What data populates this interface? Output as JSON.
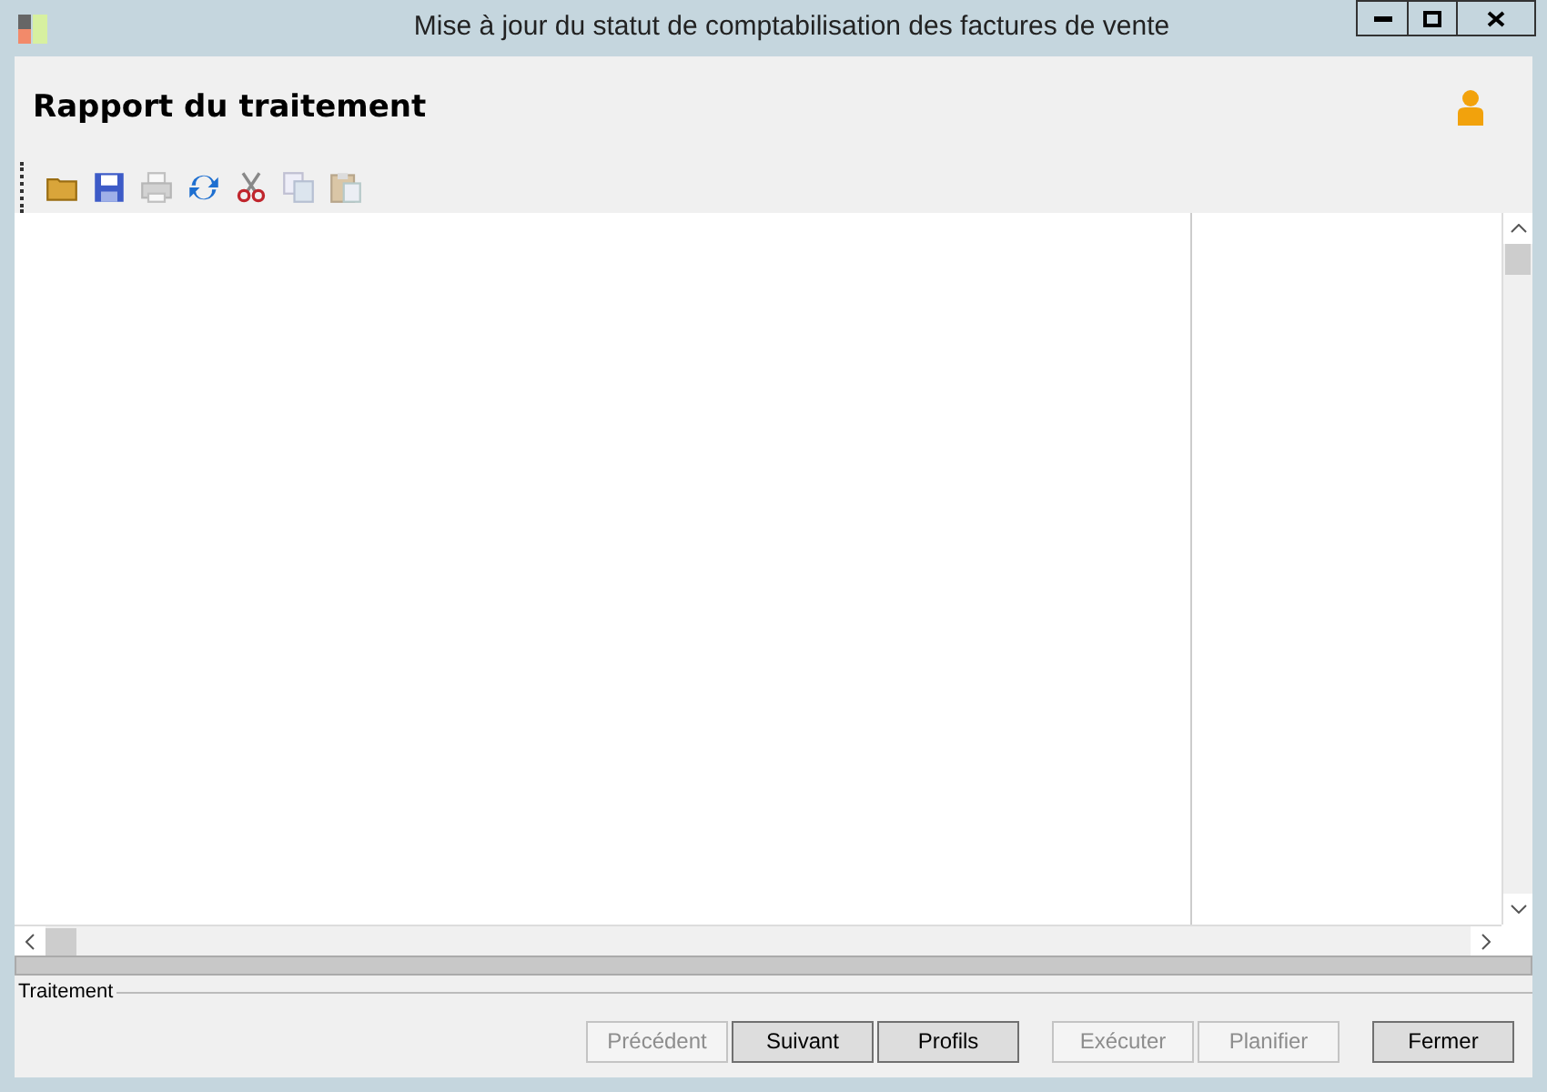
{
  "window": {
    "title": "Mise à jour du statut de comptabilisation des factures de vente"
  },
  "header": {
    "title": "Rapport du traitement"
  },
  "toolbar": {
    "buttons": [
      {
        "kind": "open",
        "disabled": false
      },
      {
        "kind": "save",
        "disabled": false
      },
      {
        "kind": "print",
        "disabled": true
      },
      {
        "kind": "refresh",
        "disabled": false
      },
      {
        "kind": "cut",
        "disabled": false
      },
      {
        "kind": "copy",
        "disabled": true
      },
      {
        "kind": "paste",
        "disabled": true
      }
    ]
  },
  "progress": {
    "level": 0
  },
  "status_group": {
    "label": "Traitement"
  },
  "buttons": [
    {
      "label": "Précédent",
      "disabled": true
    },
    {
      "label": "Suivant",
      "disabled": false
    },
    {
      "label": "Profils",
      "disabled": false
    },
    {
      "label": "Exécuter",
      "disabled": true
    },
    {
      "label": "Planifier",
      "disabled": true
    },
    {
      "label": "Fermer",
      "disabled": false
    }
  ]
}
